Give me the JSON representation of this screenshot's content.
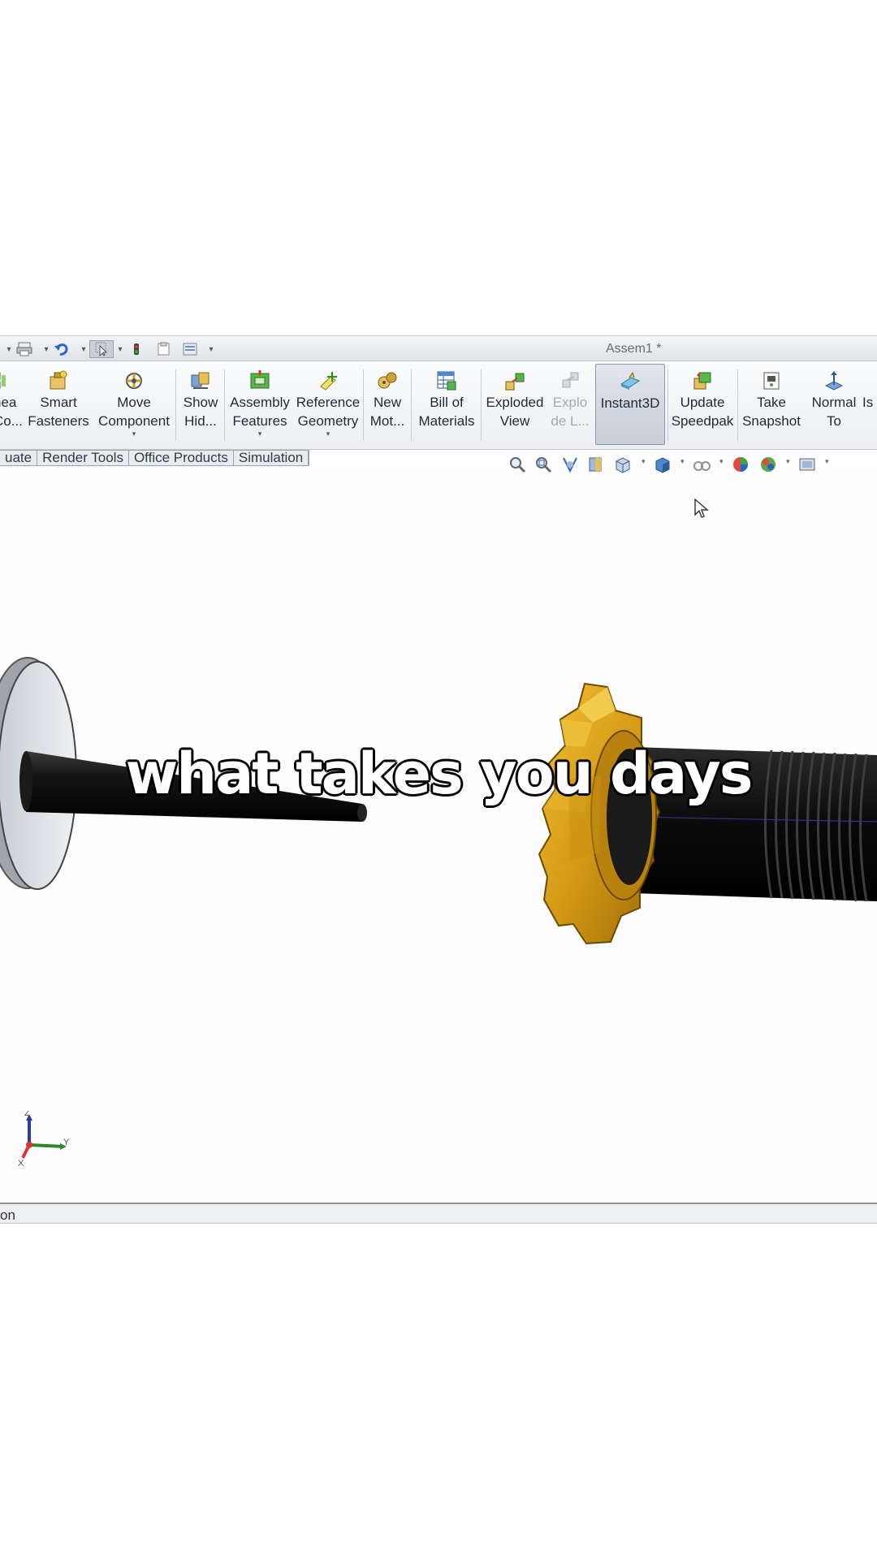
{
  "window": {
    "title": "Assem1 *"
  },
  "ribbon": {
    "commands": [
      {
        "id": "linear-component-pattern",
        "label": "nea\nCo...",
        "icon": "linear-pattern-icon",
        "state": "normal"
      },
      {
        "id": "smart-fasteners",
        "label": "Smart\nFasteners",
        "icon": "smart-fasteners-icon",
        "state": "normal"
      },
      {
        "id": "move-component",
        "label": "Move\nComponent",
        "icon": "move-component-icon",
        "state": "normal"
      },
      {
        "id": "show-hidden",
        "label": "Show\nHid...",
        "icon": "show-hidden-icon",
        "state": "normal"
      },
      {
        "id": "assembly-features",
        "label": "Assembly\nFeatures",
        "icon": "assembly-features-icon",
        "state": "normal"
      },
      {
        "id": "reference-geometry",
        "label": "Reference\nGeometry",
        "icon": "reference-geometry-icon",
        "state": "normal"
      },
      {
        "id": "new-motion-study",
        "label": "New\nMot...",
        "icon": "motion-study-icon",
        "state": "normal"
      },
      {
        "id": "bill-of-materials",
        "label": "Bill of\nMaterials",
        "icon": "bom-table-icon",
        "state": "normal"
      },
      {
        "id": "exploded-view",
        "label": "Exploded\nView",
        "icon": "exploded-view-icon",
        "state": "normal"
      },
      {
        "id": "explode-line-sketch",
        "label": "Explo\nde L...",
        "icon": "explode-line-icon",
        "state": "disabled"
      },
      {
        "id": "instant3d",
        "label": "Instant3D",
        "icon": "instant3d-icon",
        "state": "active"
      },
      {
        "id": "update-speedpak",
        "label": "Update\nSpeedpak",
        "icon": "speedpak-icon",
        "state": "normal"
      },
      {
        "id": "take-snapshot",
        "label": "Take\nSnapshot",
        "icon": "snapshot-icon",
        "state": "normal"
      },
      {
        "id": "normal-to",
        "label": "Normal\nTo",
        "icon": "normal-to-icon",
        "state": "normal"
      },
      {
        "id": "isometric",
        "label": "Is",
        "icon": "isometric-icon",
        "state": "normal"
      }
    ]
  },
  "tabs": [
    {
      "label": "uate"
    },
    {
      "label": "Render Tools"
    },
    {
      "label": "Office Products"
    },
    {
      "label": "Simulation"
    }
  ],
  "status": {
    "text": "on"
  },
  "triad": {
    "z": "Z",
    "y": "Y",
    "x": "X"
  },
  "caption": {
    "text": "what takes you days"
  },
  "colors": {
    "gear": "#d9a21a",
    "shaft": "#0d0d0d",
    "disc": "#dfe3e8",
    "ribbon_text": "#1d2a3a",
    "caption_text": "#ffffff"
  }
}
